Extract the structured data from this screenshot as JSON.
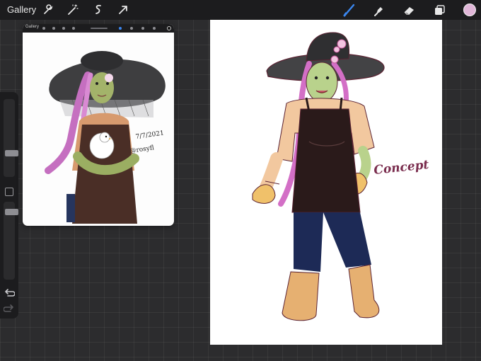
{
  "toolbar": {
    "gallery_label": "Gallery",
    "left_tools": [
      "wrench-icon",
      "magic-wand-icon",
      "selection-icon",
      "transform-arrow-icon"
    ],
    "right_tools": [
      "brush-icon",
      "smudge-icon",
      "eraser-icon",
      "layers-icon"
    ],
    "current_color": "#e0b6d8",
    "active_tool_color": "#3b87f0"
  },
  "sidebar": {
    "brush_size_level": 0.55,
    "opacity_level": 0.6,
    "icons": [
      "modify-square-icon",
      "undo-icon",
      "redo-icon"
    ]
  },
  "reference": {
    "gallery_label": "Gallery",
    "signature_date": "7/7/2021",
    "signature_handle": "@rosyfl"
  },
  "canvas": {
    "annotation": "Concept"
  }
}
